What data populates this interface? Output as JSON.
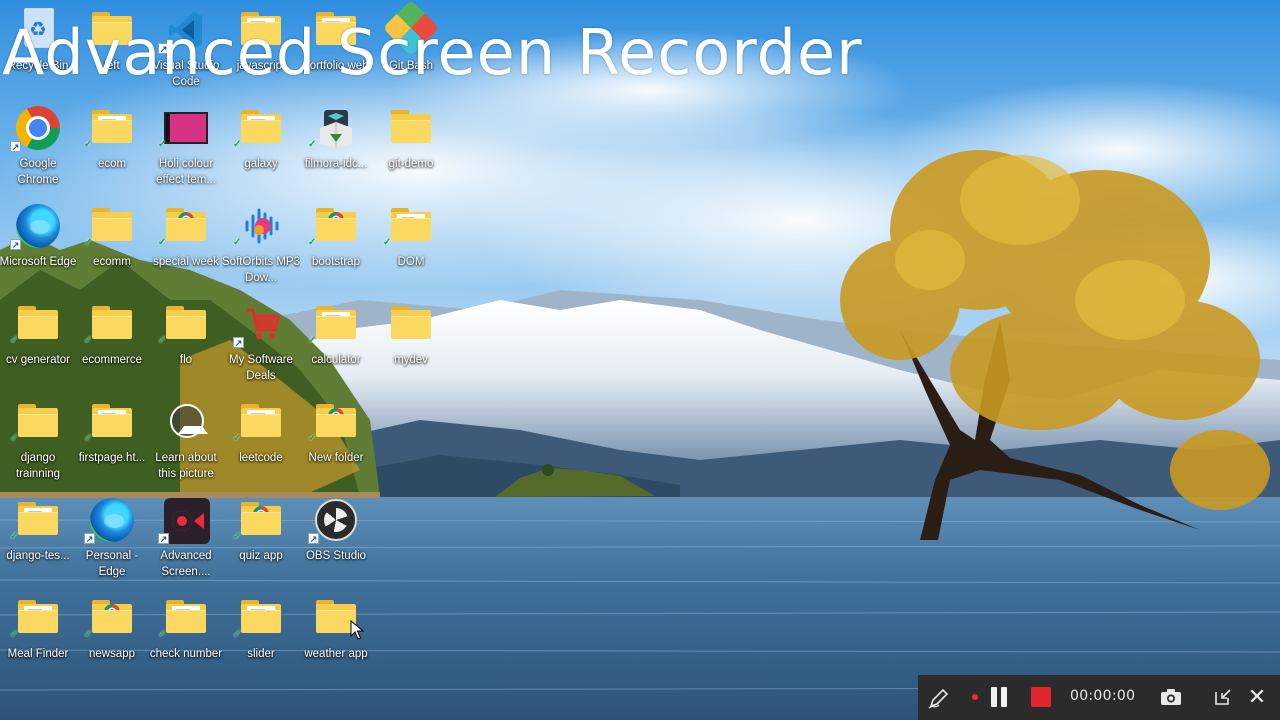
{
  "overlay": {
    "title": "Advanced Screen Recorder"
  },
  "desktop": {
    "icons": [
      {
        "label": "Recycle Bin",
        "icon": "recycle-bin-icon"
      },
      {
        "label": "left",
        "icon": "folder-icon"
      },
      {
        "label": "Visual Studio Code",
        "icon": "vscode-icon"
      },
      {
        "label": "javascript",
        "icon": "folder-icon"
      },
      {
        "label": "portfolio web",
        "icon": "folder-icon"
      },
      {
        "label": "Git Bash",
        "icon": "git-bash-icon"
      },
      {
        "label": "Google Chrome",
        "icon": "chrome-icon"
      },
      {
        "label": "ecom",
        "icon": "folder-icon"
      },
      {
        "label": "Holi colour effect tem...",
        "icon": "video-file-icon"
      },
      {
        "label": "galaxy",
        "icon": "folder-icon"
      },
      {
        "label": "filmora-idc...",
        "icon": "filmora-installer-icon"
      },
      {
        "label": "git-demo",
        "icon": "folder-icon"
      },
      {
        "label": "Microsoft Edge",
        "icon": "edge-icon"
      },
      {
        "label": "ecomm",
        "icon": "folder-icon"
      },
      {
        "label": "special week",
        "icon": "folder-chrome-icon"
      },
      {
        "label": "SoftOrbits MP3 Dow...",
        "icon": "softorbits-icon"
      },
      {
        "label": "bootstrap",
        "icon": "folder-chrome-icon"
      },
      {
        "label": "DOM",
        "icon": "folder-icon"
      },
      {
        "label": "cv generator",
        "icon": "folder-icon"
      },
      {
        "label": "ecommerce",
        "icon": "folder-icon"
      },
      {
        "label": "flo",
        "icon": "folder-icon"
      },
      {
        "label": "My Software Deals",
        "icon": "software-deals-icon"
      },
      {
        "label": "calculator",
        "icon": "folder-icon"
      },
      {
        "label": "mydev",
        "icon": "folder-icon"
      },
      {
        "label": "django trainning",
        "icon": "folder-icon"
      },
      {
        "label": "firstpage.ht...",
        "icon": "folder-icon"
      },
      {
        "label": "Learn about this picture",
        "icon": "learn-about-picture-icon"
      },
      {
        "label": "leetcode",
        "icon": "folder-icon"
      },
      {
        "label": "New folder",
        "icon": "folder-chrome-icon"
      },
      {
        "label": "django-tes...",
        "icon": "folder-icon"
      },
      {
        "label": "Personal - Edge",
        "icon": "edge-icon"
      },
      {
        "label": "Advanced Screen....",
        "icon": "advanced-screen-recorder-icon"
      },
      {
        "label": "quiz app",
        "icon": "folder-chrome-icon"
      },
      {
        "label": "OBS Studio",
        "icon": "obs-icon"
      },
      {
        "label": "Meal Finder",
        "icon": "folder-icon"
      },
      {
        "label": "newsapp",
        "icon": "folder-chrome-icon"
      },
      {
        "label": "check number",
        "icon": "folder-icon"
      },
      {
        "label": "slider",
        "icon": "folder-icon"
      },
      {
        "label": "weather app",
        "icon": "folder-icon"
      }
    ]
  },
  "recorder": {
    "timer": "00:00:00",
    "colors": {
      "background": "#2b2b2b",
      "stop": "#e3262d",
      "record_dot": "#ef2b3a"
    },
    "icons": [
      "pen-icon",
      "record-dot-icon",
      "pause-icon",
      "stop-icon",
      "camera-icon",
      "minimize-icon",
      "close-icon"
    ]
  }
}
